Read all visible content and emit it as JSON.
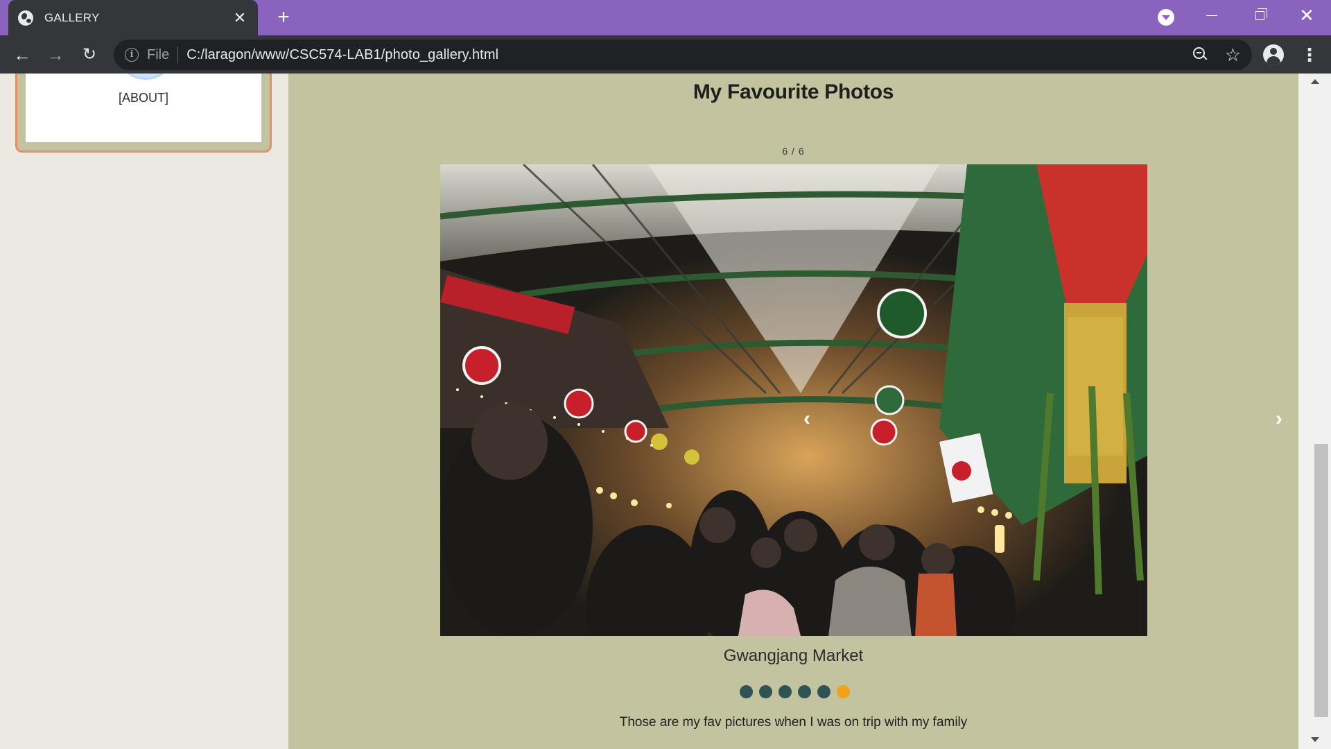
{
  "browser": {
    "tab_title": "GALLERY",
    "tab_close": "✕",
    "new_tab": "+",
    "file_label": "File",
    "url": "C:/laragon/www/CSC574-LAB1/photo_gallery.html",
    "back": "←",
    "forward": "→",
    "reload": "↻",
    "info": "i",
    "star": "☆",
    "menu": "⋮",
    "close": "✕",
    "accent_color": "#8a63be"
  },
  "sidebar": {
    "about_label": "[ABOUT]"
  },
  "main": {
    "heading": "My Favourite Photos",
    "counter": "6 / 6",
    "prev_arrow": "‹",
    "next_arrow": "›",
    "caption": "Gwangjang Market",
    "description": "Those are my fav pictures when I was on trip with my family",
    "dots": [
      {
        "active": false
      },
      {
        "active": false
      },
      {
        "active": false
      },
      {
        "active": false
      },
      {
        "active": false
      },
      {
        "active": true
      }
    ],
    "active_dot_color": "#f0a21b",
    "dot_color": "#2f5353",
    "background_color": "#c3c3a0"
  }
}
